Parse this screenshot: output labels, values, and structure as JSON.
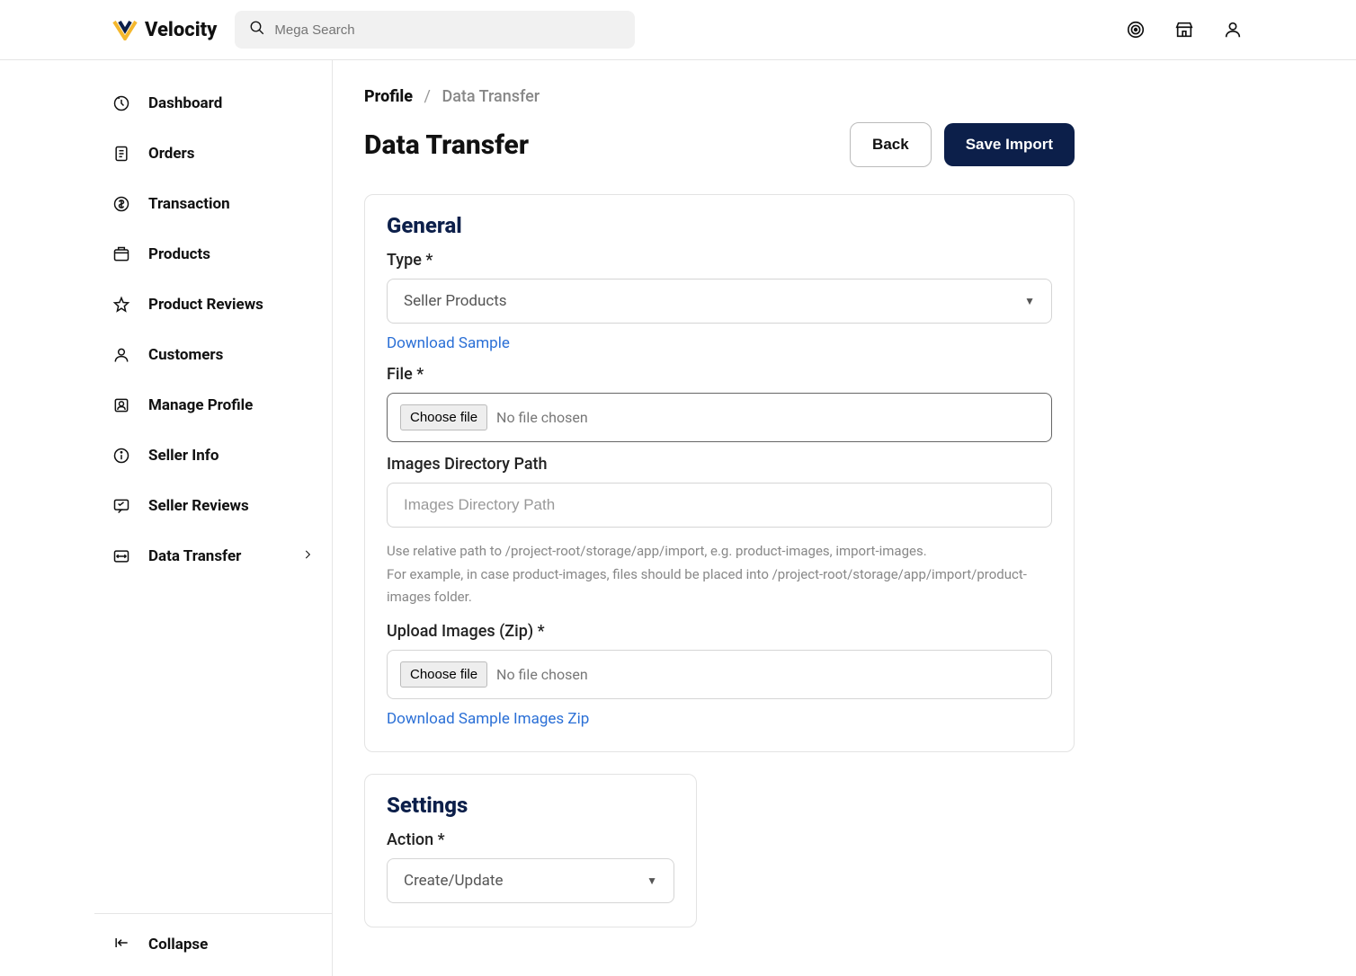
{
  "header": {
    "brand": "Velocity",
    "search_placeholder": "Mega Search"
  },
  "sidebar": {
    "items": [
      {
        "label": "Dashboard",
        "icon": "dashboard"
      },
      {
        "label": "Orders",
        "icon": "orders"
      },
      {
        "label": "Transaction",
        "icon": "transaction"
      },
      {
        "label": "Products",
        "icon": "products"
      },
      {
        "label": "Product Reviews",
        "icon": "star"
      },
      {
        "label": "Customers",
        "icon": "customers"
      },
      {
        "label": "Manage Profile",
        "icon": "profile"
      },
      {
        "label": "Seller Info",
        "icon": "info"
      },
      {
        "label": "Seller Reviews",
        "icon": "review"
      },
      {
        "label": "Data Transfer",
        "icon": "transfer",
        "chevron": true
      }
    ],
    "collapse_label": "Collapse"
  },
  "breadcrumb": {
    "profile": "Profile",
    "current": "Data Transfer"
  },
  "page": {
    "title": "Data Transfer",
    "back_button": "Back",
    "save_button": "Save Import"
  },
  "general": {
    "title": "General",
    "type_label": "Type *",
    "type_value": "Seller Products",
    "download_sample": "Download Sample",
    "file_label": "File *",
    "choose_file": "Choose file",
    "no_file": "No file chosen",
    "images_path_label": "Images Directory Path",
    "images_path_placeholder": "Images Directory Path",
    "help_line1": "Use relative path to /project-root/storage/app/import, e.g. product-images, import-images.",
    "help_line2": "For example, in case product-images, files should be placed into /project-root/storage/app/import/product-images folder.",
    "upload_zip_label": "Upload Images (Zip) *",
    "choose_file2": "Choose file",
    "no_file2": "No file chosen",
    "download_zip": "Download Sample Images Zip"
  },
  "settings": {
    "title": "Settings",
    "action_label": "Action *",
    "action_value": "Create/Update"
  }
}
